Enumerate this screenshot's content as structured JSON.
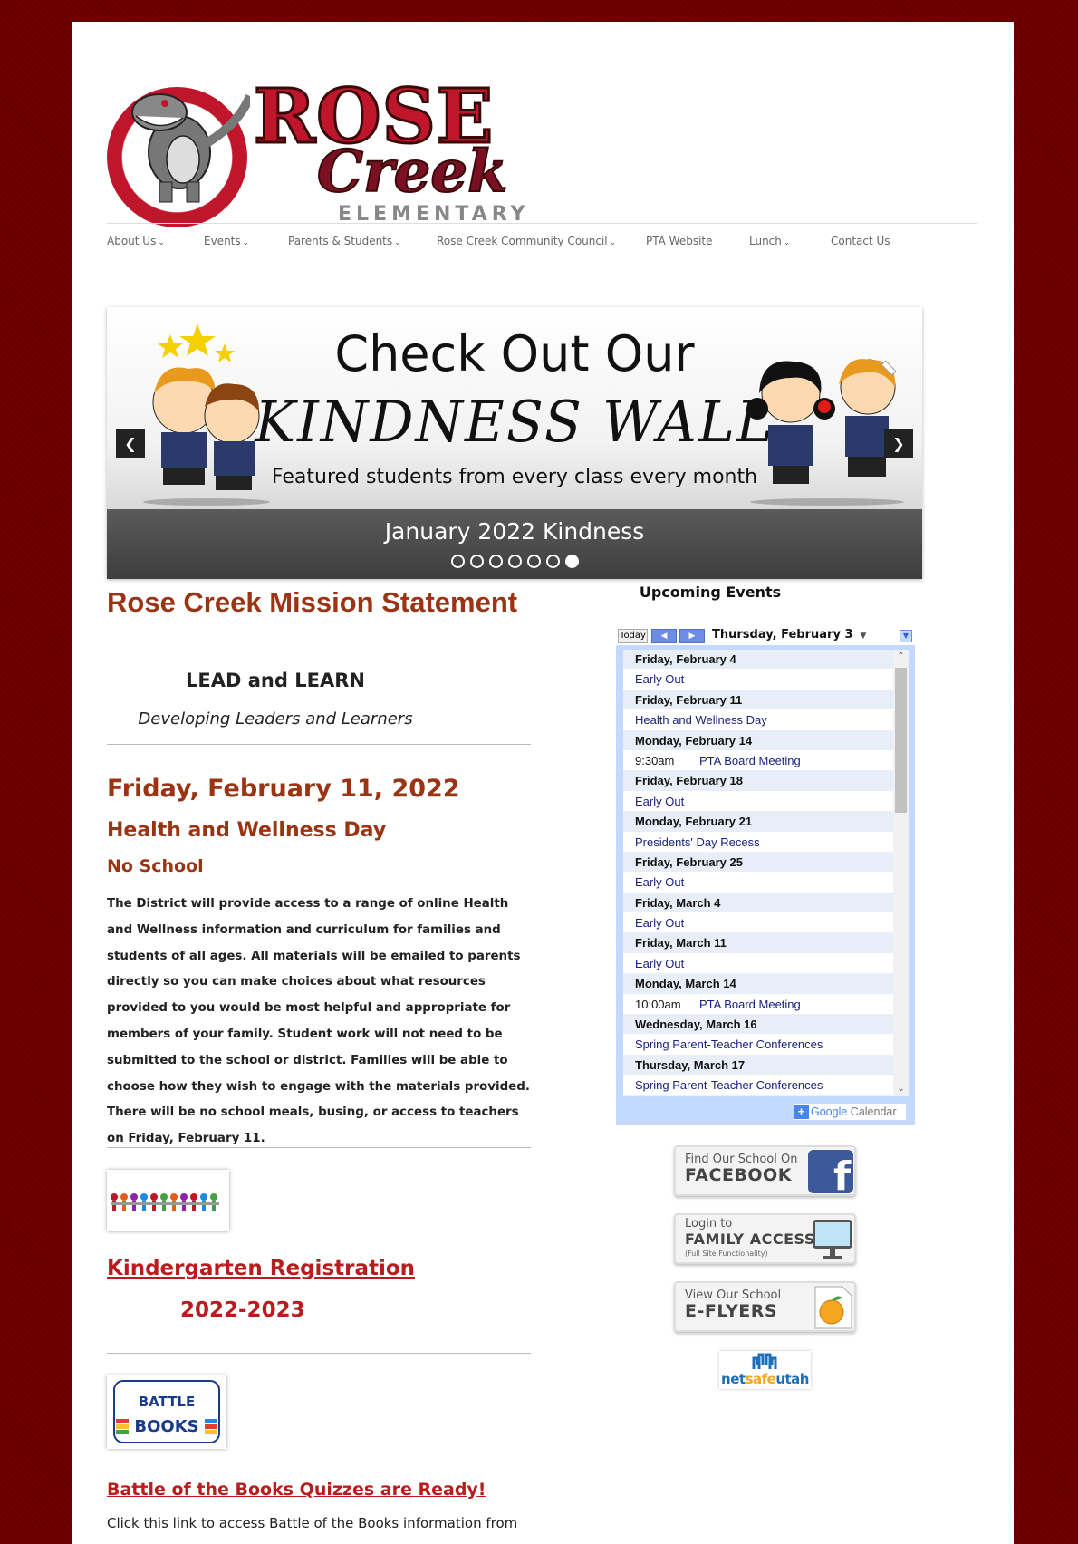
{
  "header": {
    "logo": {
      "word1": "ROSE",
      "word2": "Creek",
      "word3": "ELEMENTARY"
    }
  },
  "nav": [
    {
      "label": "About Us",
      "dropdown": true
    },
    {
      "label": "Events",
      "dropdown": true
    },
    {
      "label": "Parents & Students",
      "dropdown": true
    },
    {
      "label": "Rose Creek Community Council",
      "dropdown": true
    },
    {
      "label": "PTA Website",
      "dropdown": false
    },
    {
      "label": "Lunch",
      "dropdown": true
    },
    {
      "label": "Contact Us",
      "dropdown": false
    }
  ],
  "slider": {
    "line1": "Check Out Our",
    "line2": "KINDNESS WALL",
    "line3": "Featured students from every class every month",
    "caption": "January 2022 Kindness",
    "slide_count": 7,
    "active_slide": 7
  },
  "main": {
    "mission_title": "Rose Creek Mission Statement",
    "lead": "LEAD and LEARN",
    "dev": "Developing Leaders and Learners",
    "date_heading": "Friday, February 11, 2022",
    "hw_heading": "Health and Wellness Day",
    "no_school": "No School",
    "paragraph": "The District will provide access to a range of online Health and Wellness information and curriculum for families and students of all ages. All materials will be emailed to parents directly so you can make choices about what resources provided to you would be most helpful and appropriate for members of your family. Student work will not need to be submitted to the school or district. Families will be able to choose how they wish to engage with the materials provided. There will be no school meals, busing, or access to teachers on Friday, February 11.",
    "kg_link": "Kindergarten Registration",
    "kg_year": "2022-2023",
    "bob_image_text": "BATTLE OF THE BOOKS",
    "bob_link": "Battle of the Books Quizzes are Ready!",
    "bob_text": "Click this link to access Battle of the Books information from"
  },
  "sidebar": {
    "upcoming_title": "Upcoming Events",
    "calendar": {
      "today_label": "Today",
      "current_date": "Thursday, February 3",
      "rows": [
        {
          "type": "day",
          "text": "Friday, February 4"
        },
        {
          "type": "event",
          "time": "",
          "text": "Early Out"
        },
        {
          "type": "day",
          "text": "Friday, February 11"
        },
        {
          "type": "event",
          "time": "",
          "text": "Health and Wellness Day"
        },
        {
          "type": "day",
          "text": "Monday, February 14"
        },
        {
          "type": "event",
          "time": "9:30am",
          "text": "PTA Board Meeting"
        },
        {
          "type": "day",
          "text": "Friday, February 18"
        },
        {
          "type": "event",
          "time": "",
          "text": "Early Out"
        },
        {
          "type": "day",
          "text": "Monday, February 21"
        },
        {
          "type": "event",
          "time": "",
          "text": "Presidents' Day Recess"
        },
        {
          "type": "day",
          "text": "Friday, February 25"
        },
        {
          "type": "event",
          "time": "",
          "text": "Early Out"
        },
        {
          "type": "day",
          "text": "Friday, March 4"
        },
        {
          "type": "event",
          "time": "",
          "text": "Early Out"
        },
        {
          "type": "day",
          "text": "Friday, March 11"
        },
        {
          "type": "event",
          "time": "",
          "text": "Early Out"
        },
        {
          "type": "day",
          "text": "Monday, March 14"
        },
        {
          "type": "event",
          "time": "10:00am",
          "text": "PTA Board Meeting"
        },
        {
          "type": "day",
          "text": "Wednesday, March 16"
        },
        {
          "type": "event",
          "time": "",
          "text": "Spring Parent-Teacher Conferences"
        },
        {
          "type": "day",
          "text": "Thursday, March 17"
        },
        {
          "type": "event",
          "time": "",
          "text": "Spring Parent-Teacher Conferences"
        }
      ],
      "footer": {
        "google": "Google",
        "calendar": "Calendar"
      }
    },
    "badges": [
      {
        "line1": "Find Our School On",
        "line2": "FACEBOOK",
        "line3": "",
        "icon": "facebook-icon"
      },
      {
        "line1": "Login to",
        "line2": "FAMILY ACCESS",
        "line3": "(Full Site Functionality)",
        "icon": "monitor-icon"
      },
      {
        "line1": "View Our School",
        "line2": "E-FLYERS",
        "line3": "",
        "icon": "peach-icon"
      }
    ],
    "netsafe": {
      "part1": "net",
      "part2": "safe",
      "part3": "utah"
    }
  },
  "colors": {
    "background": "#6e0000",
    "brand_red": "#c0162c",
    "heading_brown": "#9a3412",
    "link_red": "#b91c1c",
    "calendar_blue": "#c3d9ff"
  }
}
